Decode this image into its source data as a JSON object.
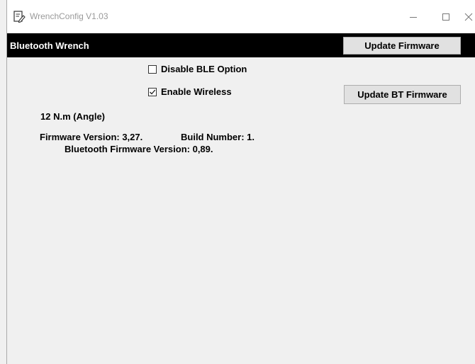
{
  "window": {
    "title": "WrenchConfig V1.03",
    "icon": "notepad-edit-icon"
  },
  "header": {
    "title": "Bluetooth Wrench",
    "update_firmware_label": "Update Firmware"
  },
  "options": {
    "disable_ble_label": "Disable BLE Option",
    "disable_ble_checked": false,
    "enable_wireless_label": "Enable Wireless",
    "enable_wireless_checked": true,
    "update_bt_firmware_label": "Update BT Firmware"
  },
  "info": {
    "torque_mode": "12 N.m (Angle)",
    "firmware_version": "Firmware Version: 3,27.",
    "build_number": "Build Number: 1.",
    "bt_firmware_version": "Bluetooth Firmware Version: 0,89."
  },
  "colors": {
    "header_bg": "#000000",
    "window_bg": "#f0f0f0",
    "button_bg": "#e1e1e1"
  }
}
